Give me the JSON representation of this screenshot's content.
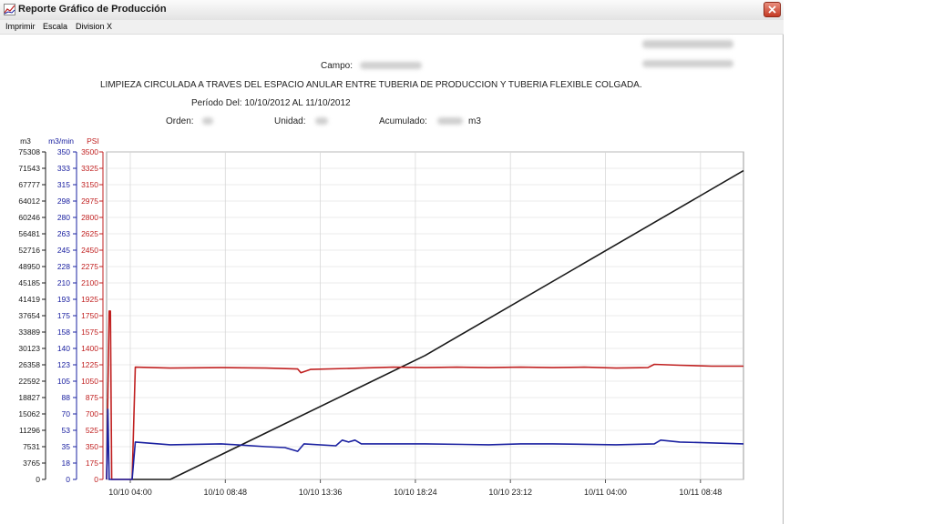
{
  "window": {
    "title": "Reporte Gráfico de Producción"
  },
  "menu": [
    "Imprimir",
    "Escala",
    "Division X"
  ],
  "report": {
    "campo_label": "Campo:",
    "description": "LIMPIEZA CIRCULADA A TRAVES DEL ESPACIO ANULAR ENTRE TUBERIA DE PRODUCCION Y TUBERIA FLEXIBLE COLGADA.",
    "periodo": "Período Del: 10/10/2012  AL 11/10/2012",
    "orden_label": "Orden:",
    "unidad_label": "Unidad:",
    "acumulado_label": "Acumulado:",
    "acumulado_unit": "m3"
  },
  "colors": {
    "accumulated": "#1a1a1a",
    "pressure": "#c02020",
    "rate": "#1a20a0",
    "grid": "#d8d8d8"
  },
  "chart_data": {
    "type": "line",
    "x_ticks": [
      "10/10 04:00",
      "10/10 08:48",
      "10/10 13:36",
      "10/10 18:24",
      "10/10 23:12",
      "10/11 04:00",
      "10/11 08:48"
    ],
    "axes": [
      {
        "unit": "m3",
        "ticks": [
          "75308",
          "71543",
          "67777",
          "64012",
          "60246",
          "56481",
          "52716",
          "48950",
          "45185",
          "41419",
          "37654",
          "33889",
          "30123",
          "26358",
          "22592",
          "18827",
          "15062",
          "11296",
          "7531",
          "3765",
          "0"
        ],
        "ylim": [
          0,
          75308
        ]
      },
      {
        "unit": "m3/min",
        "ticks": [
          "350",
          "333",
          "315",
          "298",
          "280",
          "263",
          "245",
          "228",
          "210",
          "193",
          "175",
          "158",
          "140",
          "123",
          "105",
          "88",
          "70",
          "53",
          "35",
          "18",
          "0"
        ],
        "ylim": [
          0,
          350
        ]
      },
      {
        "unit": "PSI",
        "ticks": [
          "3500",
          "3325",
          "3150",
          "2975",
          "2800",
          "2625",
          "2450",
          "2275",
          "2100",
          "1925",
          "1750",
          "1575",
          "1400",
          "1225",
          "1050",
          "875",
          "700",
          "525",
          "350",
          "175",
          "0"
        ],
        "ylim": [
          0,
          3500
        ]
      }
    ],
    "series": [
      {
        "axis": 0,
        "color": "accumulated",
        "points": [
          [
            0.04,
            0
          ],
          [
            0.1,
            0
          ],
          [
            0.5,
            28500
          ],
          [
            1.0,
            71000
          ]
        ]
      },
      {
        "axis": 2,
        "color": "pressure",
        "points": [
          [
            0.0,
            0
          ],
          [
            0.004,
            1800
          ],
          [
            0.006,
            1800
          ],
          [
            0.008,
            0
          ],
          [
            0.04,
            0
          ],
          [
            0.045,
            1200
          ],
          [
            0.1,
            1190
          ],
          [
            0.18,
            1195
          ],
          [
            0.25,
            1190
          ],
          [
            0.3,
            1180
          ],
          [
            0.305,
            1140
          ],
          [
            0.32,
            1175
          ],
          [
            0.4,
            1190
          ],
          [
            0.45,
            1200
          ],
          [
            0.5,
            1195
          ],
          [
            0.55,
            1200
          ],
          [
            0.6,
            1195
          ],
          [
            0.65,
            1200
          ],
          [
            0.7,
            1195
          ],
          [
            0.75,
            1200
          ],
          [
            0.8,
            1190
          ],
          [
            0.85,
            1195
          ],
          [
            0.86,
            1230
          ],
          [
            0.9,
            1220
          ],
          [
            0.95,
            1210
          ],
          [
            1.0,
            1210
          ]
        ]
      },
      {
        "axis": 1,
        "color": "rate",
        "points": [
          [
            0.0,
            0
          ],
          [
            0.002,
            75
          ],
          [
            0.004,
            0
          ],
          [
            0.04,
            0
          ],
          [
            0.045,
            40
          ],
          [
            0.1,
            37
          ],
          [
            0.18,
            38
          ],
          [
            0.25,
            35
          ],
          [
            0.28,
            34
          ],
          [
            0.3,
            30
          ],
          [
            0.31,
            38
          ],
          [
            0.36,
            36
          ],
          [
            0.37,
            42
          ],
          [
            0.38,
            40
          ],
          [
            0.39,
            42
          ],
          [
            0.4,
            38
          ],
          [
            0.5,
            38
          ],
          [
            0.6,
            37
          ],
          [
            0.65,
            38
          ],
          [
            0.7,
            38
          ],
          [
            0.8,
            37
          ],
          [
            0.86,
            38
          ],
          [
            0.87,
            42
          ],
          [
            0.9,
            40
          ],
          [
            1.0,
            38
          ]
        ]
      }
    ]
  }
}
